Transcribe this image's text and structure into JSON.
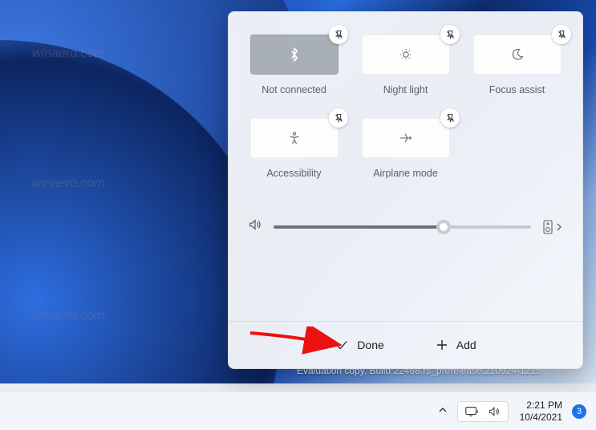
{
  "quick_settings": {
    "tiles": [
      {
        "id": "bluetooth",
        "label": "Not connected",
        "icon": "bluetooth-icon",
        "active": true
      },
      {
        "id": "night-light",
        "label": "Night light",
        "icon": "night-light-icon",
        "active": false
      },
      {
        "id": "focus-assist",
        "label": "Focus assist",
        "icon": "moon-icon",
        "active": false
      },
      {
        "id": "accessibility",
        "label": "Accessibility",
        "icon": "accessibility-icon",
        "active": false
      },
      {
        "id": "airplane-mode",
        "label": "Airplane mode",
        "icon": "airplane-icon",
        "active": false
      }
    ],
    "volume_percent": 66,
    "footer": {
      "done_label": "Done",
      "add_label": "Add"
    }
  },
  "desktop": {
    "build_text": "Evaluation copy. Build 22468.rs_prerelease.210924-1215"
  },
  "taskbar": {
    "time": "2:21 PM",
    "date": "10/4/2021",
    "notification_count": "3"
  },
  "watermark_text": "winaero.com"
}
